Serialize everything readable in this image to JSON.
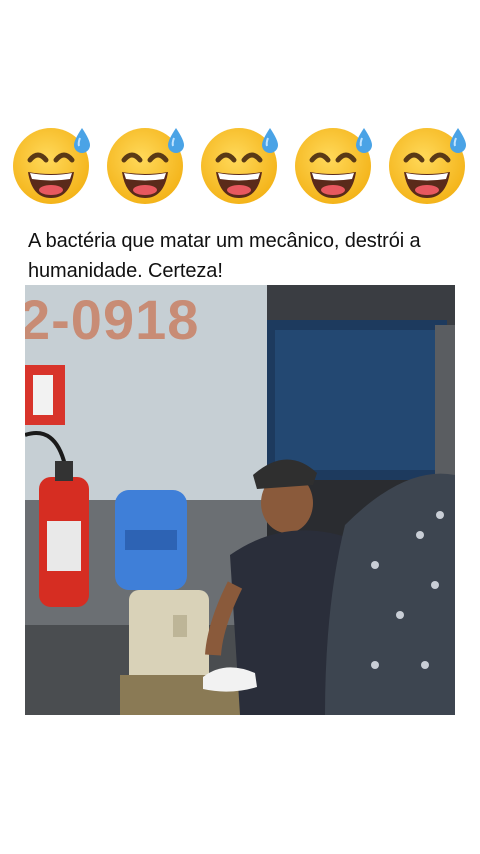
{
  "reaction": {
    "emojis": [
      {
        "icon": "grinning-face-with-sweat-icon"
      },
      {
        "icon": "grinning-face-with-sweat-icon"
      },
      {
        "icon": "grinning-face-with-sweat-icon"
      },
      {
        "icon": "grinning-face-with-sweat-icon"
      },
      {
        "icon": "grinning-face-with-sweat-icon"
      }
    ]
  },
  "post": {
    "caption": "A bactéria que matar um mecânico, destrói a humanidade. Certeza!",
    "photo": {
      "wall_text": "2-0918"
    }
  },
  "colors": {
    "background": "#ffffff",
    "emoji_face": "#f9c331",
    "sweat_drop": "#4aa3e6",
    "caption_text": "#111111"
  }
}
